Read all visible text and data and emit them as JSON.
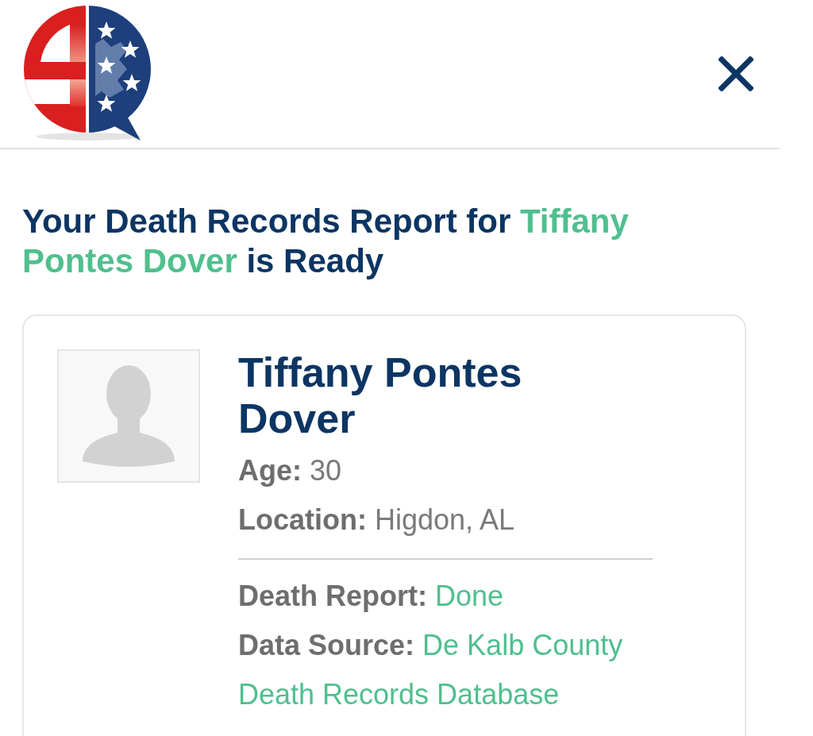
{
  "heading": {
    "prefix": "Your Death Records Report for ",
    "name": "Tiffany Pontes Dover",
    "suffix": " is Ready"
  },
  "result": {
    "name": "Tiffany Pontes Dover",
    "details": [
      "**Age:** 30",
      "**Location:** Higdon, AL"
    ],
    "report_details": [
      "**Death Report:** Done",
      "**Data Source:** De Kalb County Death Records Database"
    ]
  }
}
